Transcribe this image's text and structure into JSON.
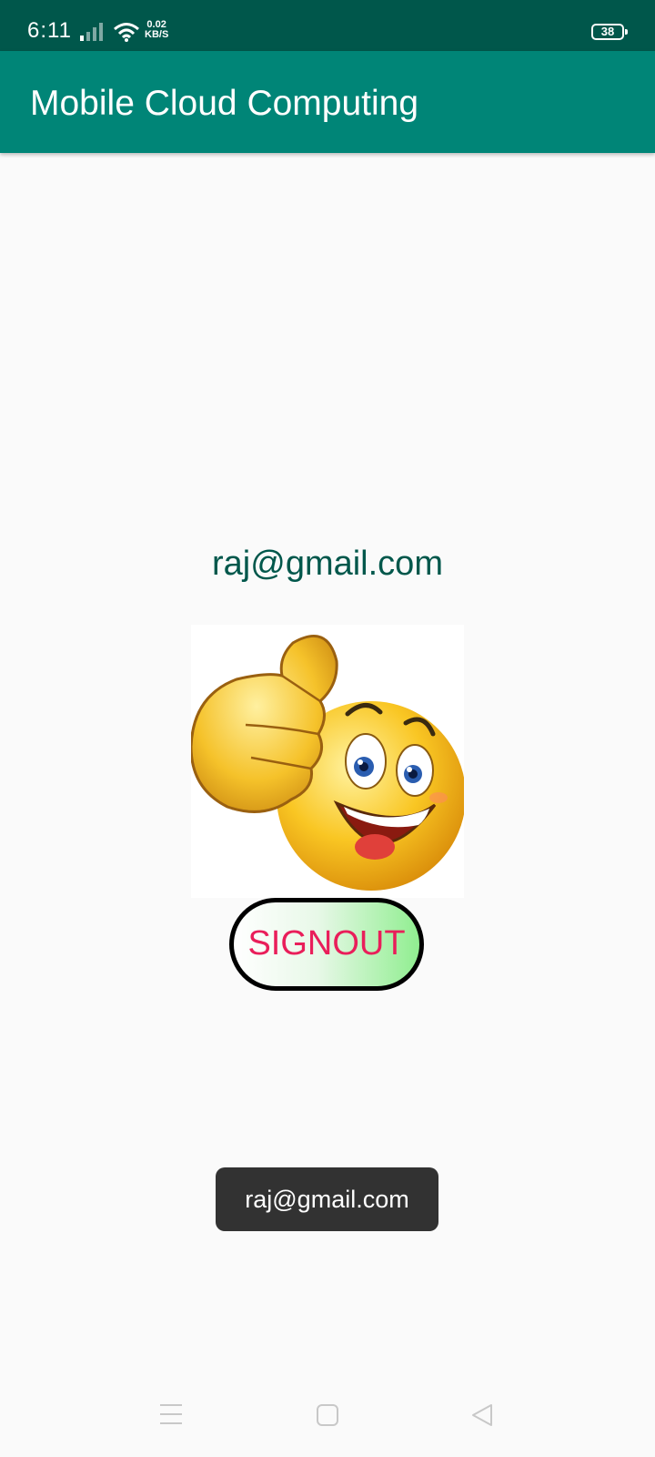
{
  "status_bar": {
    "time": "6:11",
    "net_speed_value": "0.02",
    "net_speed_unit": "KB/S",
    "battery_level": "38",
    "icons": [
      "signal-icon",
      "wifi-icon",
      "battery-icon"
    ]
  },
  "app_bar": {
    "title": "Mobile Cloud Computing",
    "background_color": "#008577"
  },
  "main": {
    "email": "raj@gmail.com",
    "image": "thumbs-up-smiley-emoji",
    "signout_label": "SIGNOUT",
    "signout_text_color": "#e91e5a"
  },
  "toast": {
    "message": "raj@gmail.com"
  },
  "nav_bar": {
    "icons": [
      "menu-icon",
      "home-icon",
      "back-icon"
    ]
  }
}
